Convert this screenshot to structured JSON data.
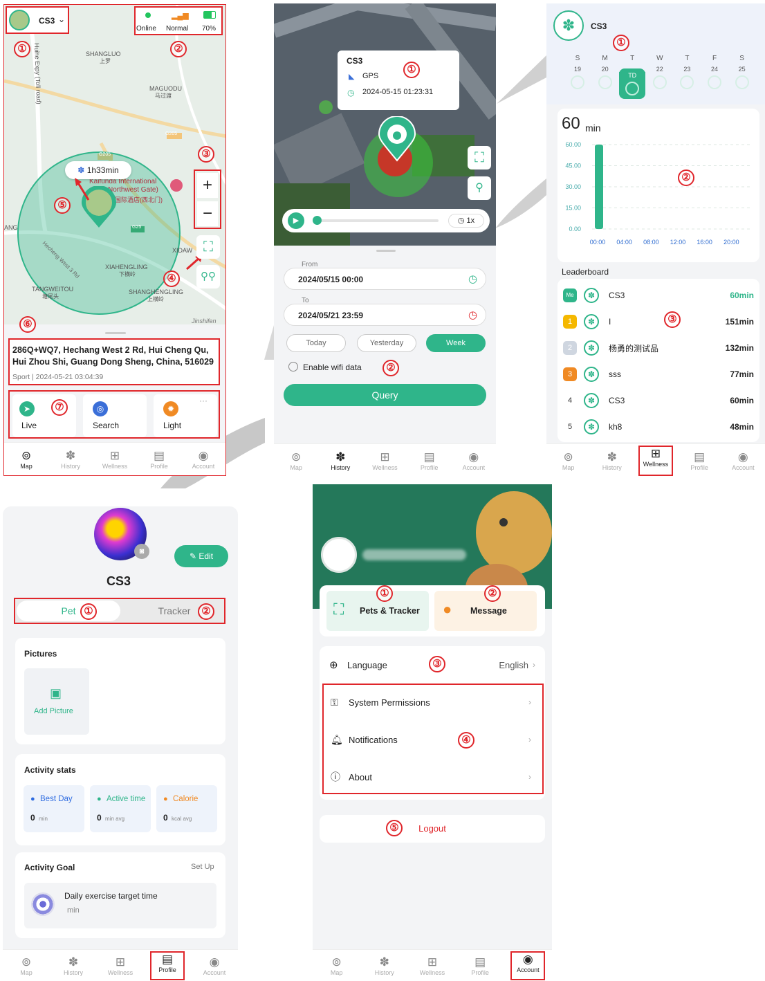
{
  "map_screen": {
    "device_name": "CS3",
    "status": {
      "online_label": "Online",
      "signal_label": "Normal",
      "battery_label": "70%"
    },
    "map_labels": {
      "shangluo": "SHANGLUO",
      "shangluo_cn": "上罗",
      "maguodu": "MAGUODU",
      "maguodu_cn": "马过渡",
      "huihe": "Huihe Expy (Toll road)",
      "g205": "G205",
      "g25": "G25",
      "xiahengling": "XIAHENGLING",
      "xiahengling_cn": "下横岭",
      "tangweitou": "TANGWEITOU",
      "tangweitou_cn": "塘尾头",
      "shanghengling": "SHANGHENGLING",
      "shanghengling_cn": "上横岭",
      "hotel1": "Kaifunda International",
      "hotel2": "Northwest Gate)",
      "hotel3": "国际酒店(西北门)",
      "hecheng": "Hecheng West 3 Rd",
      "ang": "ANG",
      "xidaw": "XIDAW",
      "jinshifen": "Jinshifen"
    },
    "duration_bubble": "1h33min",
    "address_line1": "286Q+WQ7, Hechang West 2 Rd, Hui Cheng Qu,",
    "address_line2": "Hui Zhou Shi, Guang Dong Sheng, China, 516029",
    "address_meta": "Sport | 2024-05-21 03:04:39",
    "actions": [
      {
        "label": "Live"
      },
      {
        "label": "Search"
      },
      {
        "label": "Light"
      }
    ],
    "more": "···"
  },
  "history_screen": {
    "popup": {
      "name": "CS3",
      "type": "GPS",
      "time": "2024-05-15 01:23:31"
    },
    "speed": "1x",
    "from_label": "From",
    "from_value": "2024/05/15 00:00",
    "to_label": "To",
    "to_value": "2024/05/21 23:59",
    "quick": [
      "Today",
      "Yesterday",
      "Week"
    ],
    "wifi_label": "Enable wifi data",
    "query_label": "Query"
  },
  "wellness_screen": {
    "device_name": "CS3",
    "days": [
      {
        "d": "S",
        "n": "19"
      },
      {
        "d": "M",
        "n": "20"
      },
      {
        "d": "T",
        "n": "TD"
      },
      {
        "d": "W",
        "n": "22"
      },
      {
        "d": "T",
        "n": "23"
      },
      {
        "d": "F",
        "n": "24"
      },
      {
        "d": "S",
        "n": "25"
      }
    ],
    "total_value": "60",
    "total_unit": "min",
    "leaderboard_title": "Leaderboard",
    "leaderboard": [
      {
        "rank": "Me",
        "name": "CS3",
        "value": "60min"
      },
      {
        "rank": "1",
        "name": "I",
        "value": "151min"
      },
      {
        "rank": "2",
        "name": "杨勇的测试品",
        "value": "132min"
      },
      {
        "rank": "3",
        "name": "sss",
        "value": "77min"
      },
      {
        "rank": "4",
        "name": "CS3",
        "value": "60min"
      },
      {
        "rank": "5",
        "name": "kh8",
        "value": "48min"
      }
    ]
  },
  "chart_data": {
    "type": "bar",
    "categories": [
      "00:00",
      "04:00",
      "08:00",
      "12:00",
      "16:00",
      "20:00"
    ],
    "values": [
      60,
      0,
      0,
      0,
      0,
      0
    ],
    "ylim": [
      0,
      60
    ],
    "y_ticks": [
      "60.00",
      "45.00",
      "30.00",
      "15.00",
      "0.00"
    ],
    "grid": true,
    "bar_color": "#2fb58a"
  },
  "profile_screen": {
    "edit_label": "Edit",
    "pet_name": "CS3",
    "tab_pet": "Pet",
    "tab_tracker": "Tracker",
    "pictures_title": "Pictures",
    "add_picture": "Add Picture",
    "stats_title": "Activity stats",
    "stats": [
      {
        "label": "Best Day",
        "value": "0",
        "unit": "min",
        "color": "#2f6ce0"
      },
      {
        "label": "Active time",
        "value": "0",
        "unit": "min avg",
        "color": "#2fb58a"
      },
      {
        "label": "Calorie",
        "value": "0",
        "unit": "kcal avg",
        "color": "#f08a24"
      }
    ],
    "goal_title": "Activity Goal",
    "goal_setup": "Set Up",
    "goal_text": "Daily exercise target time",
    "goal_unit": "min"
  },
  "account_screen": {
    "pets_tracker": "Pets & Tracker",
    "message": "Message",
    "language_label": "Language",
    "language_value": "English",
    "permissions": "System Permissions",
    "notifications": "Notifications",
    "about": "About",
    "logout": "Logout"
  },
  "tabs": [
    "Map",
    "History",
    "Wellness",
    "Profile",
    "Account"
  ],
  "markers": [
    "①",
    "②",
    "③",
    "④",
    "⑤",
    "⑥",
    "⑦"
  ],
  "colors": {
    "accent": "#2fb58a",
    "annotation": "#e0262b"
  }
}
